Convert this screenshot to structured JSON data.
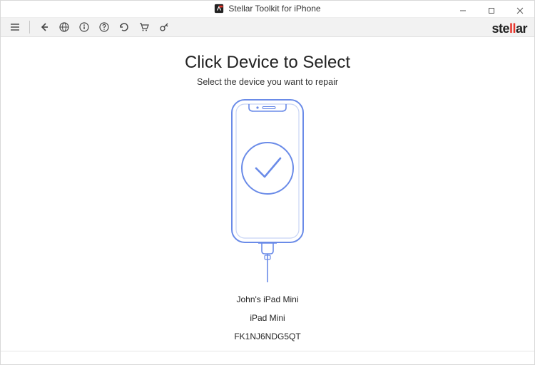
{
  "titlebar": {
    "title": "Stellar Toolkit for iPhone"
  },
  "brand": {
    "pre": "ste",
    "mid": "ll",
    "post": "ar"
  },
  "main": {
    "heading": "Click Device to Select",
    "subtitle": "Select the device you want to repair"
  },
  "device": {
    "name": "John's iPad Mini",
    "model": "iPad Mini",
    "serial": "FK1NJ6NDG5QT"
  }
}
